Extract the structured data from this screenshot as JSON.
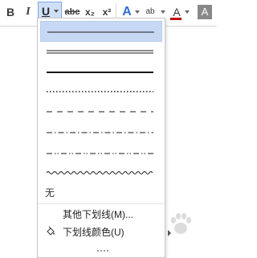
{
  "ribbon": {
    "bold_label": "B",
    "italic_label": "I",
    "underline_label": "U",
    "strikethrough_label": "abc",
    "subscript_label": "x₂",
    "superscript_label": "x²",
    "text_effect_label": "A",
    "highlight_label": "ab",
    "font_color_label": "A",
    "char_shading_label": "A",
    "highlight_color": "#f2e600",
    "font_color": "#c00000"
  },
  "underline_menu": {
    "line_styles": [
      {
        "name": "single",
        "selected": true
      },
      {
        "name": "double",
        "selected": false
      },
      {
        "name": "thick",
        "selected": false
      },
      {
        "name": "dotted",
        "selected": false
      },
      {
        "name": "dashed",
        "selected": false
      },
      {
        "name": "dash-dot",
        "selected": false
      },
      {
        "name": "dash-dot-dot",
        "selected": false
      },
      {
        "name": "wave",
        "selected": false
      }
    ],
    "none_label": "无",
    "more_underlines_label": "其他下划线(M)...",
    "underline_color_label": "下划线颜色(U)",
    "selected_color": "#c6d8f3"
  }
}
